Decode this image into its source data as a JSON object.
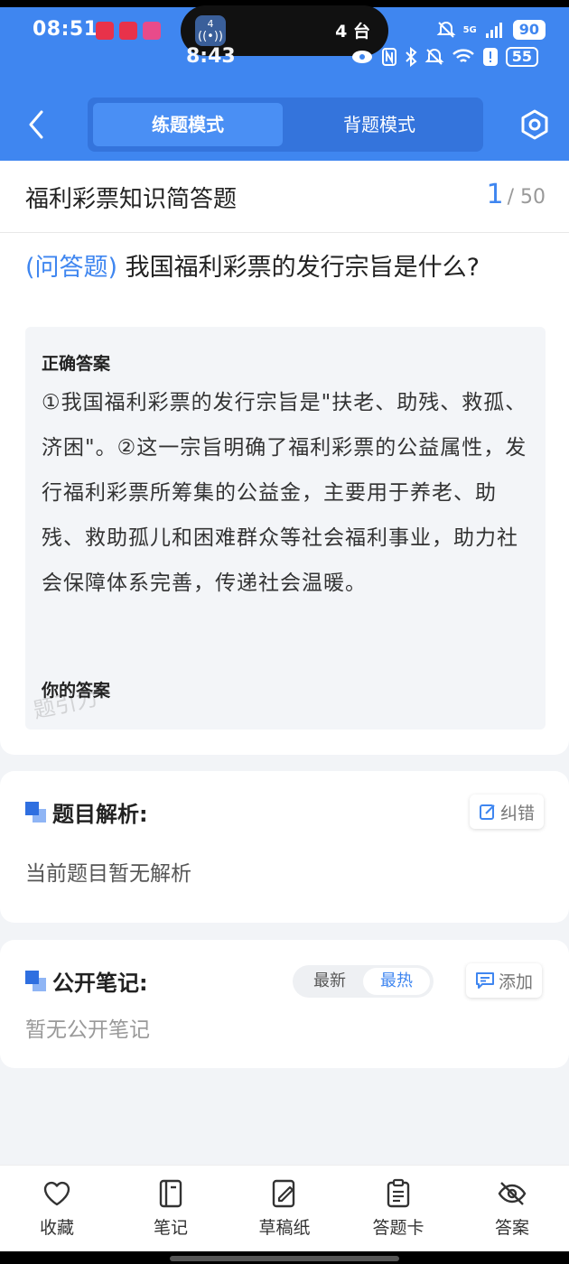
{
  "status": {
    "time": "08:51",
    "time2": "8:43",
    "island_count": "4 台",
    "island_badge": "4",
    "battery": "90",
    "battery2": "55",
    "network": "5G"
  },
  "nav": {
    "mode_practice": "练题模式",
    "mode_memorize": "背题模式"
  },
  "header": {
    "title": "福利彩票知识简答题",
    "current": "1",
    "total": "/ 50"
  },
  "question": {
    "tag": "(问答题)",
    "text": "我国福利彩票的发行宗旨是什么?",
    "answer_label": "正确答案",
    "answer": "①我国福利彩票的发行宗旨是\"扶老、助残、救孤、济困\"。②这一宗旨明确了福利彩票的公益属性，发行福利彩票所筹集的公益金，主要用于养老、助残、救助孤儿和困难群众等社会福利事业，助力社会保障体系完善，传递社会温暖。",
    "your_answer_label": "你的答案",
    "watermark": "题引力"
  },
  "analysis": {
    "title": "题目解析:",
    "correct_label": "纠错",
    "empty": "当前题目暂无解析"
  },
  "notes": {
    "title": "公开笔记:",
    "sort_latest": "最新",
    "sort_hot": "最热",
    "add_label": "添加",
    "empty": "暂无公开笔记"
  },
  "bottom": {
    "items": [
      {
        "label": "收藏",
        "icon": "heart-icon"
      },
      {
        "label": "笔记",
        "icon": "notebook-icon"
      },
      {
        "label": "草稿纸",
        "icon": "draft-icon"
      },
      {
        "label": "答题卡",
        "icon": "clipboard-icon"
      },
      {
        "label": "答案",
        "icon": "eye-off-icon"
      }
    ]
  },
  "colors": {
    "primary": "#3f86f0",
    "background": "#f2f4f7"
  }
}
